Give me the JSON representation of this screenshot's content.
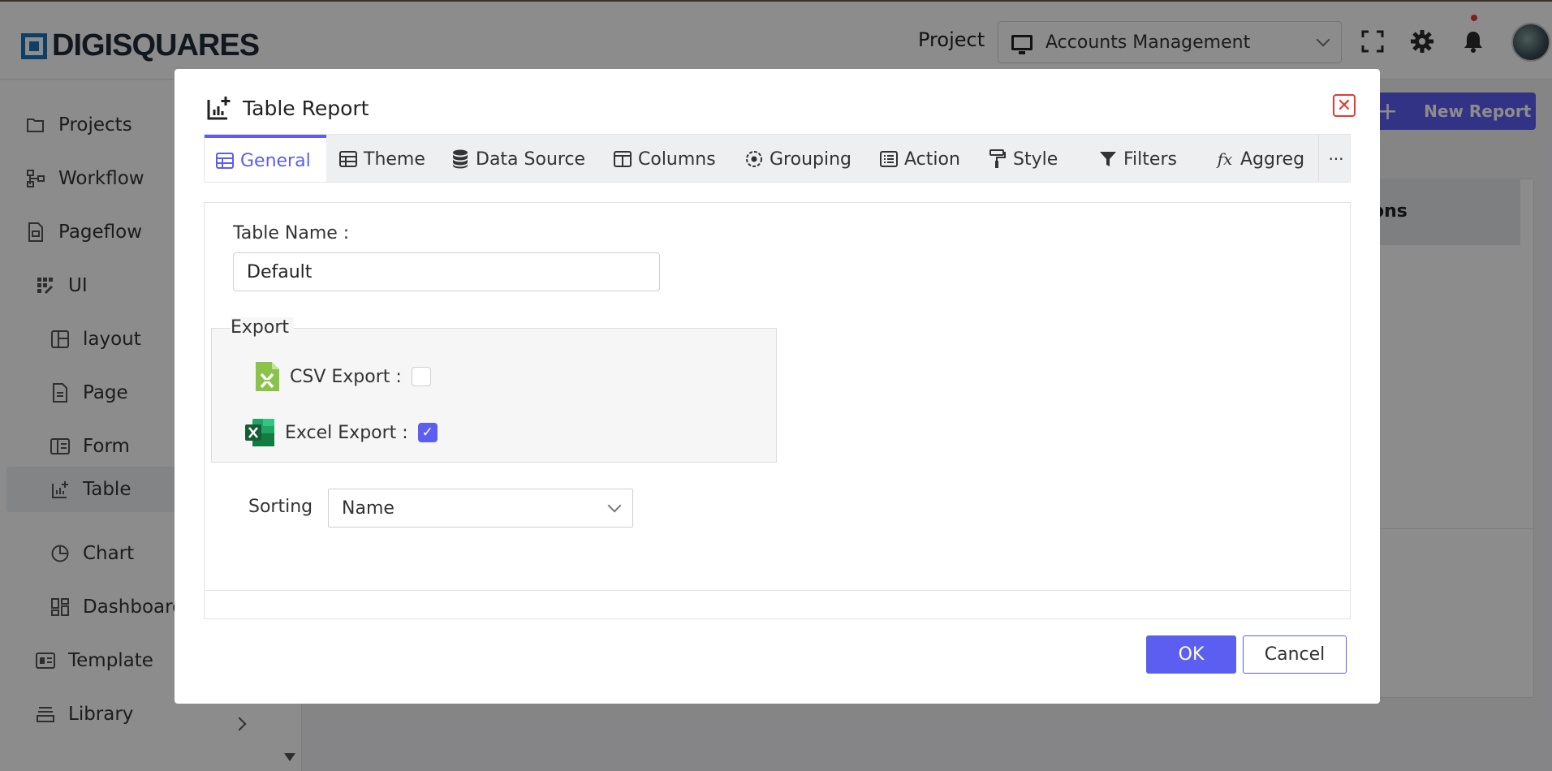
{
  "app": {
    "logo_text": "DIGISQUARES",
    "project_label": "Project",
    "project_value": "Accounts Management",
    "new_report_label": "New Report",
    "panel_header_fragment": "ons"
  },
  "sidebar": {
    "items": [
      {
        "label": "Projects",
        "icon": "folder-icon"
      },
      {
        "label": "Workflow",
        "icon": "workflow-icon"
      },
      {
        "label": "Pageflow",
        "icon": "pageflow-icon"
      },
      {
        "label": "UI",
        "icon": "ui-icon"
      },
      {
        "label": "layout",
        "icon": "layout-icon"
      },
      {
        "label": "Page",
        "icon": "page-icon"
      },
      {
        "label": "Form",
        "icon": "form-icon"
      },
      {
        "label": "Table",
        "icon": "table-chart-icon"
      },
      {
        "label": "Chart",
        "icon": "pie-chart-icon"
      },
      {
        "label": "Dashboard",
        "icon": "dashboard-icon"
      },
      {
        "label": "Template",
        "icon": "template-icon"
      },
      {
        "label": "Library",
        "icon": "library-icon"
      }
    ]
  },
  "modal": {
    "title": "Table Report",
    "tabs": [
      {
        "label": "General",
        "icon": "table-icon"
      },
      {
        "label": "Theme",
        "icon": "table-icon"
      },
      {
        "label": "Data Source",
        "icon": "database-icon"
      },
      {
        "label": "Columns",
        "icon": "columns-icon"
      },
      {
        "label": "Grouping",
        "icon": "grouping-icon"
      },
      {
        "label": "Action",
        "icon": "list-icon"
      },
      {
        "label": "Style",
        "icon": "paint-roller-icon"
      },
      {
        "label": "Filters",
        "icon": "filter-icon"
      },
      {
        "label": "Aggreg",
        "icon": "function-icon"
      }
    ],
    "more_label": "···",
    "general": {
      "table_name_label": "Table Name :",
      "table_name_value": "Default",
      "export_legend": "Export",
      "csv_label": "CSV Export :",
      "csv_checked": false,
      "excel_label": "Excel Export :",
      "excel_checked": true,
      "sorting_label": "Sorting",
      "sorting_value": "Name"
    },
    "ok_label": "OK",
    "cancel_label": "Cancel"
  },
  "colors": {
    "accent": "#5b5ef0",
    "close": "#e53935",
    "csv_green": "#8bc34a",
    "excel_green": "#1d7044",
    "logo_blue": "#1b75bb"
  }
}
